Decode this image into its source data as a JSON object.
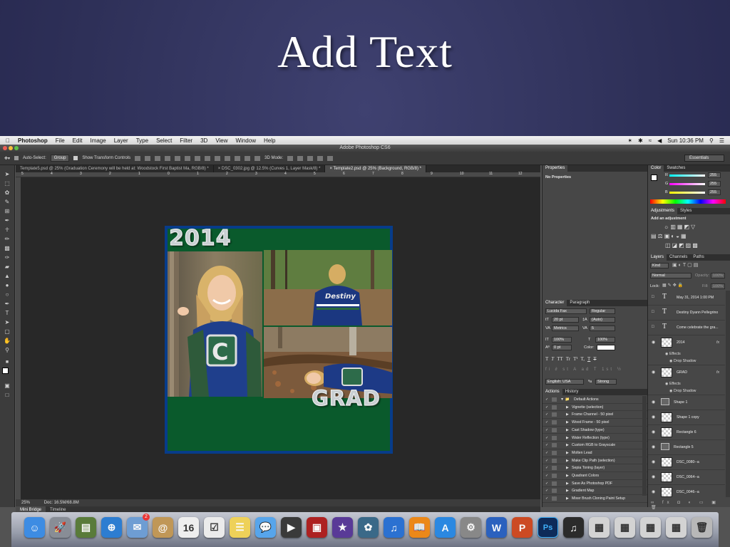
{
  "slide": {
    "title": "Add Text"
  },
  "menubar": {
    "apple": "",
    "items": [
      "Photoshop",
      "File",
      "Edit",
      "Image",
      "Layer",
      "Type",
      "Select",
      "Filter",
      "3D",
      "View",
      "Window",
      "Help"
    ],
    "clock": "Sun 10:36 PM"
  },
  "window": {
    "title": "Adobe Photoshop CS6"
  },
  "options": {
    "auto_select_label": "Auto-Select:",
    "auto_select_value": "Group",
    "transform_label": "Show Transform Controls",
    "mode_3d": "3D Mode:",
    "workspace": "Essentials"
  },
  "doc_tabs": [
    "Template5.psd @ 25% (Graduation Ceremony will be held at: Woodstock First Baptist Ma, RGB/8) *",
    "× DSC_0302.jpg @ 12.5% (Curves 1, Layer Mask/8) *",
    "× Template2.psd @ 25% (Background, RGB/8) *"
  ],
  "ruler_ticks": [
    "5",
    "4",
    "3",
    "2",
    "1",
    "0",
    "1",
    "2",
    "3",
    "4",
    "5",
    "6",
    "7",
    "8",
    "9",
    "10",
    "11",
    "12"
  ],
  "artwork": {
    "year": "2014",
    "grad": "GRAD"
  },
  "status": {
    "zoom": "25%",
    "doc": "Doc: 16.5M/68.8M"
  },
  "bottom_tabs": [
    "Mini Bridge",
    "Timeline"
  ],
  "properties": {
    "tab": "Properties",
    "empty": "No Properties"
  },
  "character": {
    "tabs": [
      "Character",
      "Paragraph"
    ],
    "font": "Lucida Fax",
    "style": "Regular",
    "size": "20 pt",
    "leading": "(Auto)",
    "kerning": "Metrics",
    "tracking": "5",
    "vscale": "100%",
    "hscale": "100%",
    "baseline": "0 pt",
    "color_label": "Color:",
    "language": "English: USA",
    "aa": "Strong",
    "type_buttons": [
      "T",
      "T",
      "TT",
      "Tr",
      "T¹",
      "T,",
      "T",
      "T"
    ]
  },
  "actions": {
    "tabs": [
      "Actions",
      "History"
    ],
    "items": [
      "Default Actions",
      "Vignette (selection)",
      "Frame Channel - 50 pixel",
      "Wood Frame - 50 pixel",
      "Cast Shadow (type)",
      "Water Reflection (type)",
      "Custom RGB to Grayscale",
      "Molten Lead",
      "Make Clip Path (selection)",
      "Sepia Toning (layer)",
      "Quadrant Colors",
      "Save As Photoshop PDF",
      "Gradient Map",
      "Mixer Brush Cloning Paint Setup"
    ]
  },
  "color_panel": {
    "tabs": [
      "Color",
      "Swatches"
    ],
    "r": "255",
    "g": "255",
    "b": "255",
    "r_label": "R",
    "g_label": "G",
    "b_label": "B"
  },
  "adjustments": {
    "tabs": [
      "Adjustments",
      "Styles"
    ],
    "hint": "Add an adjustment"
  },
  "layers": {
    "tabs": [
      "Layers",
      "Channels",
      "Paths"
    ],
    "kind": "Kind",
    "blend": "Normal",
    "opacity_label": "Opacity:",
    "opacity": "100%",
    "lock_label": "Lock:",
    "fill_label": "Fill:",
    "fill": "100%",
    "items": [
      {
        "name": "May 31, 2014 1:00 PM",
        "type": "text"
      },
      {
        "name": "Destiny Dyann Pellegrino",
        "type": "text"
      },
      {
        "name": "Come celebrate the  gra...",
        "type": "text"
      },
      {
        "name": "2014",
        "type": "fx",
        "effects": "Effects",
        "sub": "Drop Shadow"
      },
      {
        "name": "GRAD",
        "type": "fx",
        "effects": "Effects",
        "sub": "Drop Shadow"
      },
      {
        "name": "Shape 1",
        "type": "group"
      },
      {
        "name": "Shape 1 copy",
        "type": "layer"
      },
      {
        "name": "Rectangle 6",
        "type": "layer"
      },
      {
        "name": "Rectangle 5",
        "type": "group"
      },
      {
        "name": "DSC_0080--a",
        "type": "layer"
      },
      {
        "name": "DSC_0064--a",
        "type": "layer"
      },
      {
        "name": "DSC_0046--a",
        "type": "layer"
      }
    ],
    "fx": "fx"
  },
  "dock": {
    "apps": [
      "finder",
      "launchpad",
      "calendar-app",
      "safari",
      "mail",
      "contacts",
      "calendar",
      "reminders",
      "notes",
      "messages",
      "facetime",
      "photo-booth",
      "imovie",
      "iphoto",
      "itunes",
      "ibooks",
      "app-store",
      "system-preferences",
      "word",
      "powerpoint",
      "photoshop",
      "music",
      "stack",
      "stack",
      "stack",
      "stack",
      "trash"
    ],
    "calendar_day": "16",
    "mail_badge": "2"
  }
}
